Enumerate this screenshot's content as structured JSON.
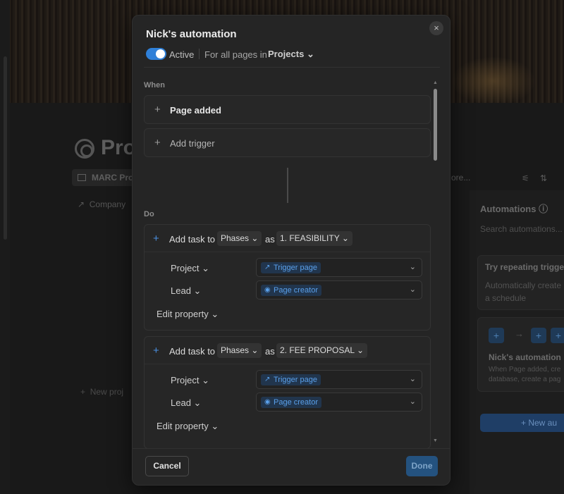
{
  "background": {
    "page_title": "Pro",
    "view_tab": "MARC Pro",
    "more_link": "ore...",
    "company_prop": "Company",
    "new_page": "New proj",
    "sort_icon": "arrows-icon",
    "filter_icon": "filter-icon"
  },
  "side_panel": {
    "title": "Automations",
    "info_icon": "ⓘ",
    "search_placeholder": "Search automations...",
    "promo_title": "Try repeating trigger",
    "promo_text_1": "Automatically create",
    "promo_text_2": "a schedule",
    "card_title": "Nick's automation",
    "card_text_1": "When Page added, cre",
    "card_text_2": "database, create a pag",
    "new_button": "New au"
  },
  "modal": {
    "title": "Nick's automation",
    "close_glyph": "×",
    "active_label": "Active",
    "scope_text": "For all pages in",
    "database": "Projects",
    "when_label": "When",
    "trigger_1": "Page added",
    "add_trigger": "Add trigger",
    "do_label": "Do",
    "actions": [
      {
        "prefix": "Add task to",
        "database": "Phases",
        "as_word": "as",
        "template": "1. FEASIBILITY",
        "properties": [
          {
            "label": "Project",
            "value": "Trigger page",
            "icon": "↗"
          },
          {
            "label": "Lead",
            "value": "Page creator",
            "icon": "◉"
          }
        ],
        "edit_label": "Edit property"
      },
      {
        "prefix": "Add task to",
        "database": "Phases",
        "as_word": "as",
        "template": "2. FEE PROPOSAL",
        "properties": [
          {
            "label": "Project",
            "value": "Trigger page",
            "icon": "↗"
          },
          {
            "label": "Lead",
            "value": "Page creator",
            "icon": "◉"
          }
        ],
        "edit_label": "Edit property"
      }
    ],
    "cancel": "Cancel",
    "done": "Done"
  },
  "colors": {
    "accent": "#2f80d8",
    "tag_text": "#5aa0ea",
    "done_button": "#24527f"
  }
}
